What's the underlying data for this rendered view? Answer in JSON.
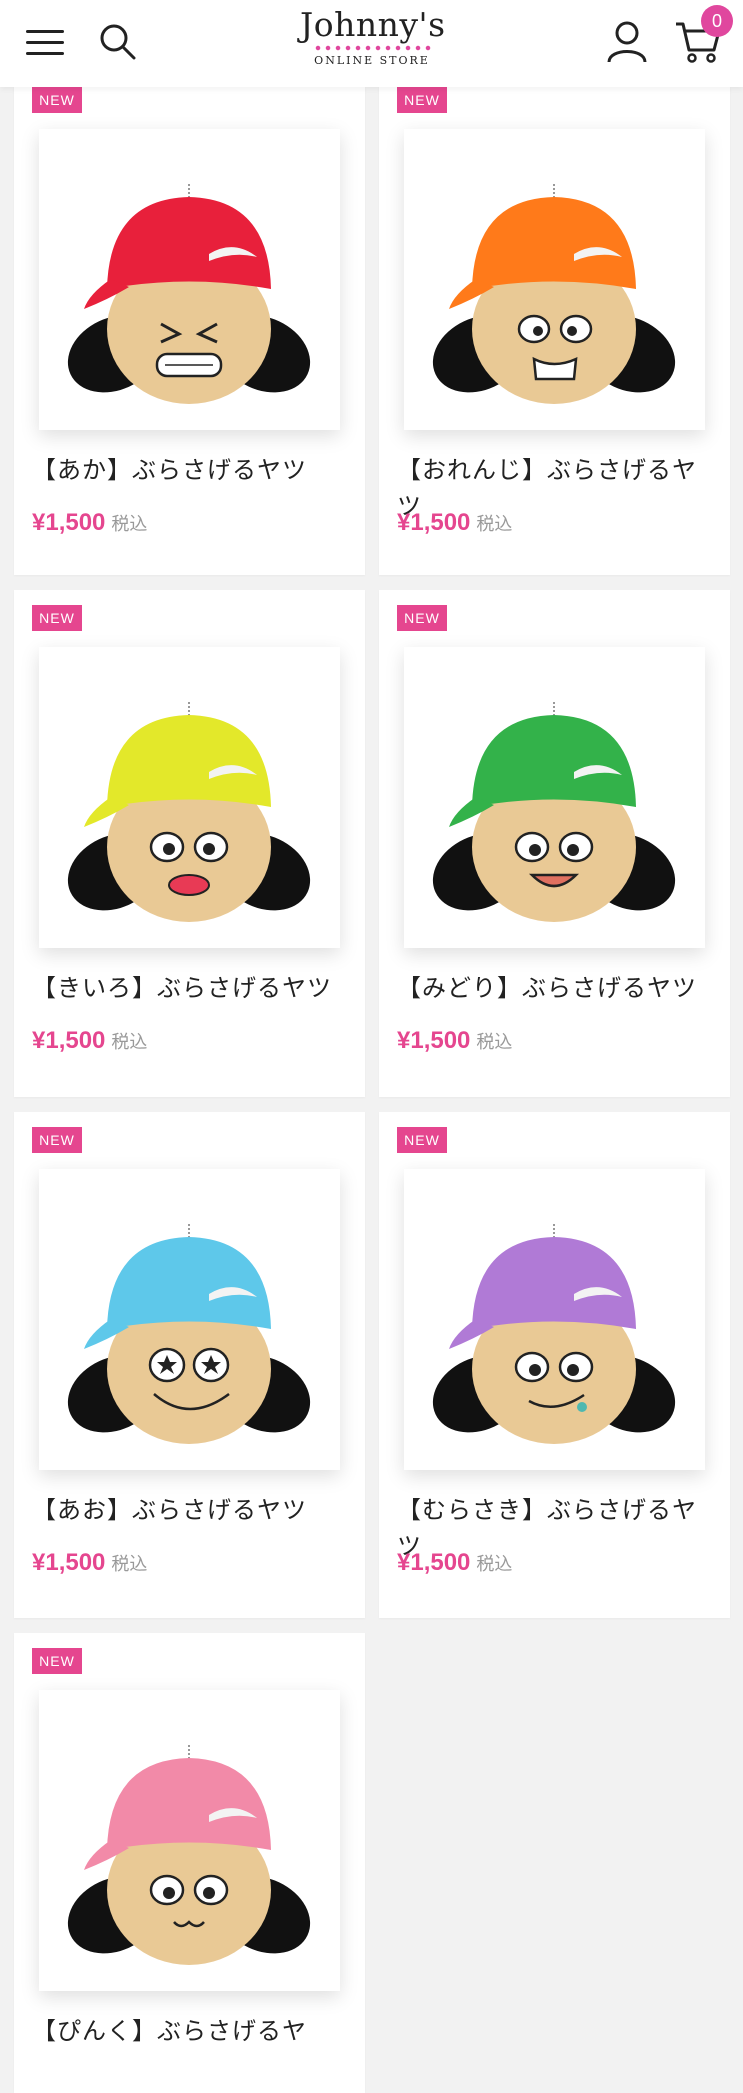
{
  "header": {
    "logo_main": "Johnny's",
    "logo_sub": "ONLINE STORE",
    "cart_count": "0"
  },
  "colors": {
    "accent": "#e5468f",
    "background": "#f2f2f2"
  },
  "products": [
    {
      "badge": "NEW",
      "name": "【あか】ぶらさげるヤツ",
      "price": "¥1,500",
      "tax": "税込",
      "cap_color": "#e8203b"
    },
    {
      "badge": "NEW",
      "name": "【おれんじ】ぶらさげるヤツ",
      "price": "¥1,500",
      "tax": "税込",
      "cap_color": "#ff7a1a"
    },
    {
      "badge": "NEW",
      "name": "【きいろ】ぶらさげるヤツ",
      "price": "¥1,500",
      "tax": "税込",
      "cap_color": "#e3e82a"
    },
    {
      "badge": "NEW",
      "name": "【みどり】ぶらさげるヤツ",
      "price": "¥1,500",
      "tax": "税込",
      "cap_color": "#33b24a"
    },
    {
      "badge": "NEW",
      "name": "【あお】ぶらさげるヤツ",
      "price": "¥1,500",
      "tax": "税込",
      "cap_color": "#5ec8ea"
    },
    {
      "badge": "NEW",
      "name": "【むらさき】ぶらさげるヤツ",
      "price": "¥1,500",
      "tax": "税込",
      "cap_color": "#b07ad6"
    },
    {
      "badge": "NEW",
      "name": "【ぴんく】ぶらさげるヤ",
      "price": "",
      "tax": "",
      "cap_color": "#f28aa8"
    }
  ]
}
